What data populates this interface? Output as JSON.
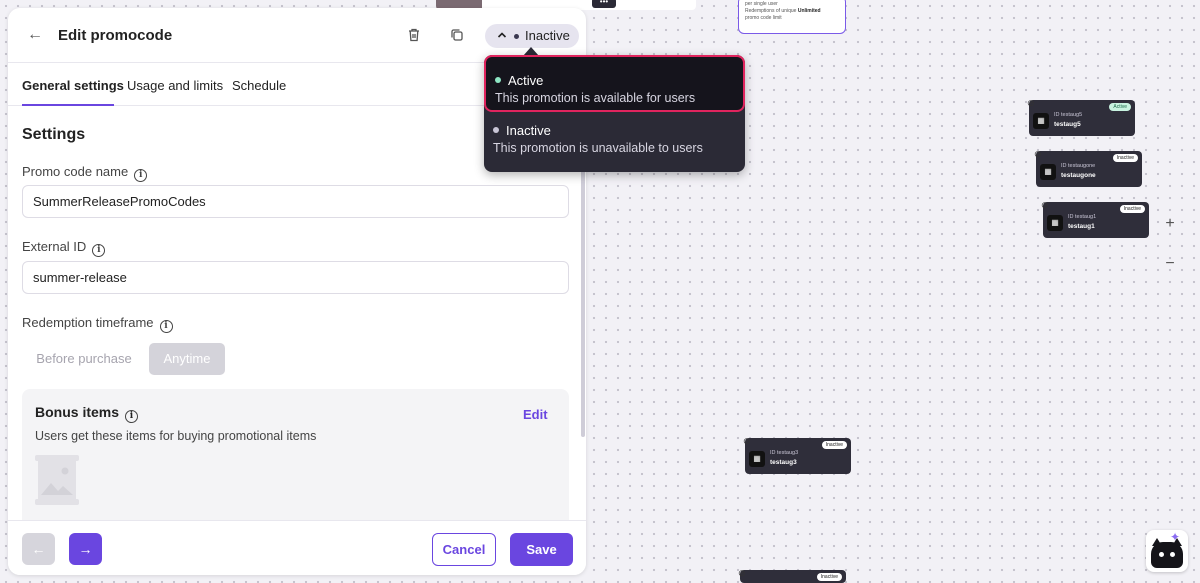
{
  "canvas": {
    "top_card_lines": [
      "per single user",
      "Redemptions of unique"
    ],
    "top_card_value": "Unlimited",
    "top_card_line3": "promo code limit",
    "more_label": "•••",
    "nodes": [
      {
        "id": "ID testaug5",
        "name": "testaug5",
        "status": "Active"
      },
      {
        "id": "ID testaugone",
        "name": "testaugone",
        "status": "Inactive"
      },
      {
        "id": "ID testaug1",
        "name": "testaug1",
        "status": "Inactive"
      },
      {
        "id": "ID testaug3",
        "name": "testaug3",
        "status": "Inactive"
      },
      {
        "id": "",
        "name": "",
        "status": "Inactive"
      }
    ],
    "zoom_in": "+",
    "zoom_out": "−"
  },
  "panel": {
    "title": "Edit promocode",
    "status_value": "Inactive",
    "tabs": [
      "General settings",
      "Usage and limits",
      "Schedule"
    ],
    "section_title": "Settings",
    "promo_name_label": "Promo code name",
    "promo_name_value": "SummerReleasePromoCodes",
    "external_id_label": "External ID",
    "external_id_value": "summer-release",
    "redemption_label": "Redemption timeframe",
    "redemption_options": [
      "Before purchase",
      "Anytime"
    ],
    "redemption_selected": "Anytime",
    "bonus": {
      "title": "Bonus items",
      "edit_label": "Edit",
      "description": "Users get these items for buying promotional items"
    },
    "footer": {
      "prev_label": "←",
      "next_label": "→",
      "cancel_label": "Cancel",
      "save_label": "Save"
    }
  },
  "dropdown": {
    "options": [
      {
        "label": "Active",
        "description": "This promotion is available for users",
        "dot_color": "#8ee6c4"
      },
      {
        "label": "Inactive",
        "description": "This promotion is unavailable to users",
        "dot_color": "#c9c6d6"
      }
    ]
  },
  "colors": {
    "accent": "#6a46e0",
    "highlight_border": "#e0245e"
  }
}
